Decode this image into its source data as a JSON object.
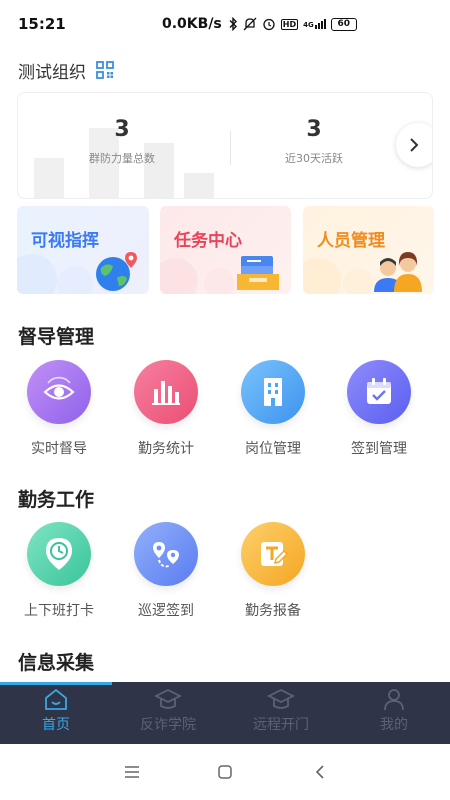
{
  "status_bar": {
    "time": "15:21",
    "net_speed": "0.0KB/s",
    "network": "4G",
    "battery": "60"
  },
  "org": {
    "title": "测试组织"
  },
  "stats": [
    {
      "value": "3",
      "label": "群防力量总数"
    },
    {
      "value": "3",
      "label": "近30天活跃"
    }
  ],
  "features": [
    {
      "label": "可视指挥",
      "icon": "globe-icon"
    },
    {
      "label": "任务中心",
      "icon": "inbox-icon"
    },
    {
      "label": "人员管理",
      "icon": "people-icon"
    }
  ],
  "sections": {
    "supervision": {
      "title": "督导管理",
      "items": [
        {
          "label": "实时督导",
          "icon": "eye-icon",
          "color": "#a877f0"
        },
        {
          "label": "勤务统计",
          "icon": "bar-chart-icon",
          "color": "#ef5b84"
        },
        {
          "label": "岗位管理",
          "icon": "building-icon",
          "color": "#4aa6f7"
        },
        {
          "label": "签到管理",
          "icon": "calendar-check-icon",
          "color": "#6e74f4"
        }
      ]
    },
    "duty": {
      "title": "勤务工作",
      "items": [
        {
          "label": "上下班打卡",
          "icon": "clock-pin-icon",
          "color": "#4dcfa8"
        },
        {
          "label": "巡逻签到",
          "icon": "route-icon",
          "color": "#6e8ff5"
        },
        {
          "label": "勤务报备",
          "icon": "edit-doc-icon",
          "color": "#f7b733"
        }
      ]
    },
    "info": {
      "title": "信息采集"
    }
  },
  "tabbar": [
    {
      "label": "首页",
      "icon": "home-icon",
      "active": true
    },
    {
      "label": "反诈学院",
      "icon": "graduation-cap-icon",
      "active": false
    },
    {
      "label": "远程开门",
      "icon": "graduation-cap-icon",
      "active": false
    },
    {
      "label": "我的",
      "icon": "user-icon",
      "active": false
    }
  ],
  "colors": {
    "accent": "#37a7e6",
    "tabbar_bg": "#2f3448"
  }
}
